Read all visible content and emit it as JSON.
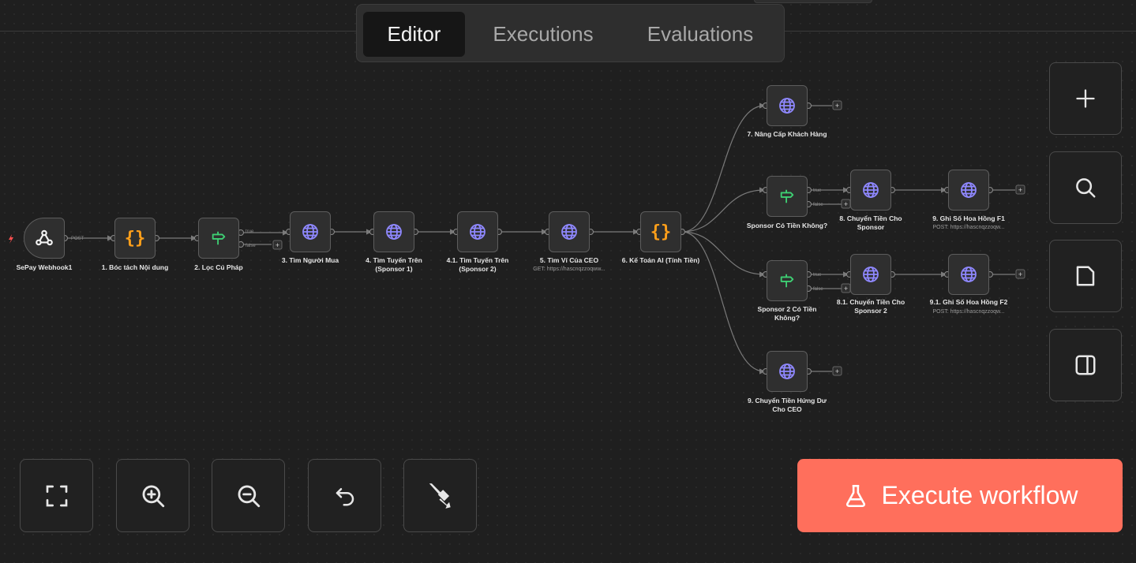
{
  "tabs": {
    "editor": "Editor",
    "executions": "Executions",
    "evaluations": "Evaluations",
    "active": "Editor"
  },
  "nodes": {
    "webhook": {
      "label": "SePay Webhook1",
      "icon": "webhook-icon"
    },
    "n1": {
      "label": "1. Bóc tách Nội dung",
      "icon": "code-braces-icon"
    },
    "n2": {
      "label": "2. Lọc Cú Pháp",
      "icon": "signpost-icon"
    },
    "n3": {
      "label": "3. Tìm Người Mua",
      "icon": "globe-icon"
    },
    "n4": {
      "label_line1": "4. Tìm Tuyến Trên",
      "label_line2": "(Sponsor 1)",
      "icon": "globe-icon"
    },
    "n41": {
      "label_line1": "4.1. Tìm Tuyến Trên",
      "label_line2": "(Sponsor 2)",
      "icon": "globe-icon"
    },
    "n5": {
      "label": "5. Tìm Ví Của CEO",
      "subtitle": "GET: https://hascnqzzoqww...",
      "icon": "globe-icon"
    },
    "n6": {
      "label": "6. Kế Toán AI (Tính Tiền)",
      "icon": "code-braces-icon"
    },
    "n7": {
      "label": "7. Nâng Cấp Khách Hàng",
      "icon": "globe-icon"
    },
    "sp1": {
      "label": "Sponsor Có Tiền Không?",
      "icon": "signpost-icon"
    },
    "n8": {
      "label_line1": "8. Chuyển Tiền Cho",
      "label_line2": "Sponsor",
      "icon": "globe-icon"
    },
    "n9f1": {
      "label": "9. Ghi Số Hoa Hồng F1",
      "subtitle": "POST: https://hascnqzzoqw...",
      "icon": "globe-icon"
    },
    "sp2": {
      "label_line1": "Sponsor 2 Có Tiền",
      "label_line2": "Không?",
      "icon": "signpost-icon"
    },
    "n81": {
      "label_line1": "8.1. Chuyển Tiền Cho",
      "label_line2": "Sponsor 2",
      "icon": "globe-icon"
    },
    "n91f2": {
      "label": "9.1. Ghi Số Hoa Hồng F2",
      "subtitle": "POST: https://hascnqzzoqw...",
      "icon": "globe-icon"
    },
    "n9ceo": {
      "label_line1": "9. Chuyển Tiền Hứng Dư",
      "label_line2": "Cho CEO",
      "icon": "globe-icon"
    }
  },
  "edges": {
    "post": "POST",
    "true": "true",
    "false": "false",
    "add": "+"
  },
  "side_controls": [
    "plus-icon",
    "search-icon",
    "sticky-note-icon",
    "panel-icon"
  ],
  "bottom_controls": [
    "fit-view-icon",
    "zoom-in-icon",
    "zoom-out-icon",
    "undo-icon",
    "broom-icon"
  ],
  "execute": {
    "label": "Execute workflow",
    "icon": "flask-icon"
  },
  "colors": {
    "accent": "#ff6f5c",
    "globe": "#8f88ff",
    "braces": "#ff9f1a",
    "signpost": "#3ecf73",
    "trigger": "#ff5050"
  }
}
